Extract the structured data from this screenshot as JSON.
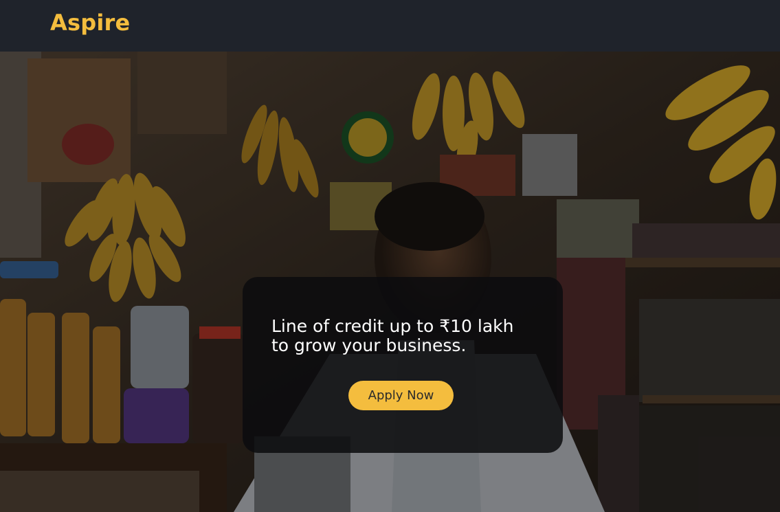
{
  "navbar": {
    "brand": "Aspire",
    "brand_color": "#f4bd3e",
    "background": "#1f232b"
  },
  "hero": {
    "image": "shopkeeper-storefront-photo",
    "card": {
      "line1": "Line of credit up to ₹10 lakh",
      "line2": "to grow your business.",
      "cta_label": "Apply Now",
      "cta_color": "#f4bd3e"
    }
  }
}
